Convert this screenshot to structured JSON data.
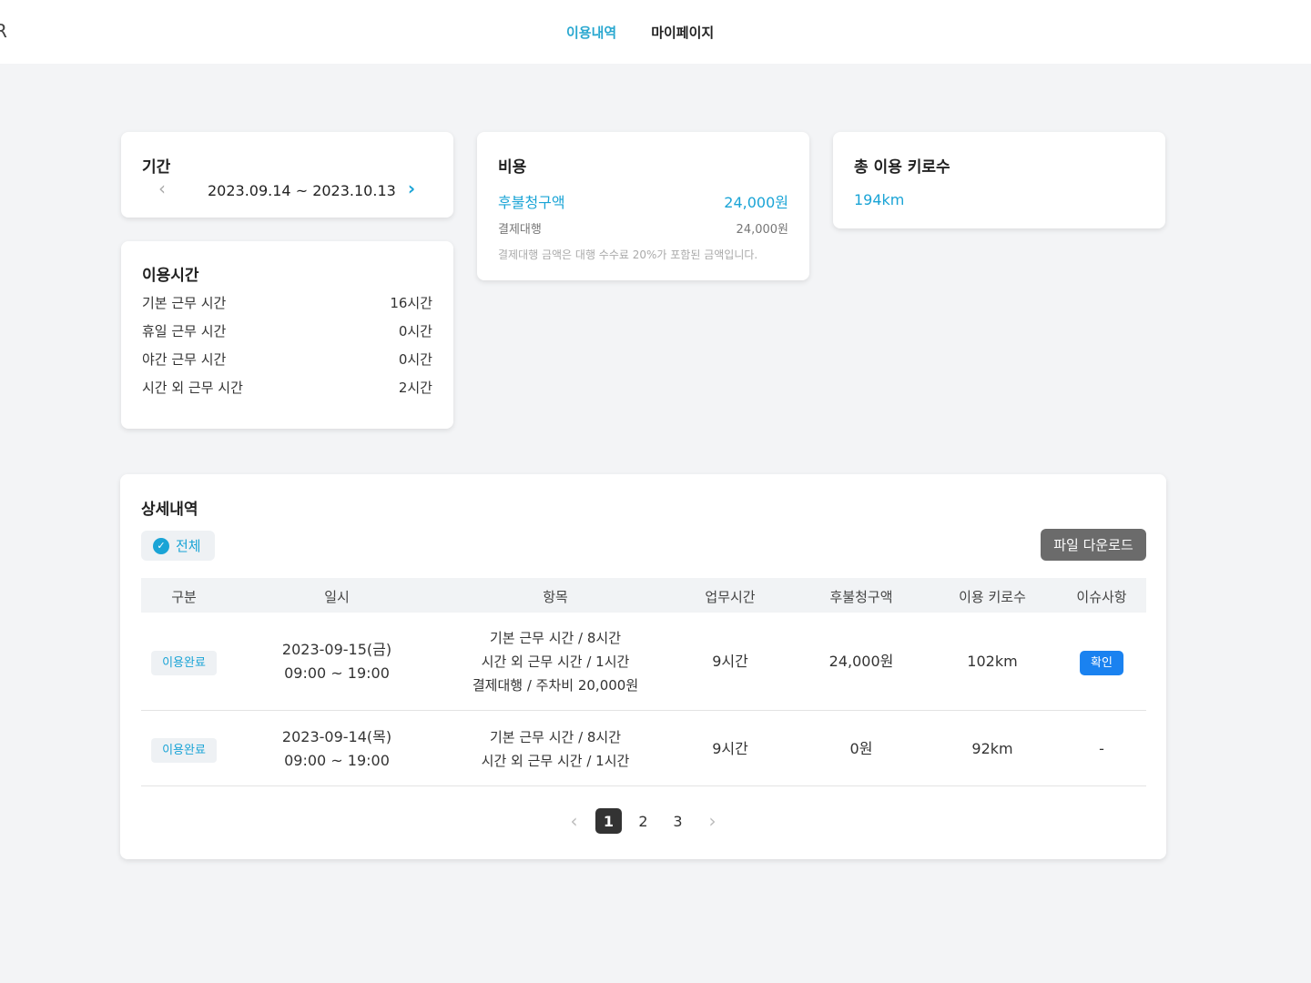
{
  "header": {
    "logo": "R",
    "nav": [
      {
        "label": "이용내역",
        "active": true
      },
      {
        "label": "마이페이지",
        "active": false
      }
    ],
    "accent_color": "#2aa8d0"
  },
  "period": {
    "title": "기간",
    "range": "2023.09.14 ~ 2023.10.13",
    "prev_icon": "chevron-left-icon",
    "next_icon": "chevron-right-icon"
  },
  "usage_time": {
    "title": "이용시간",
    "rows": [
      {
        "label": "기본 근무 시간",
        "value": "16시간"
      },
      {
        "label": "휴일 근무 시간",
        "value": "0시간"
      },
      {
        "label": "야간 근무 시간",
        "value": "0시간"
      },
      {
        "label": "시간 외 근무 시간",
        "value": "2시간"
      }
    ]
  },
  "cost": {
    "title": "비용",
    "postpaid_label": "후불청구액",
    "postpaid_value": "24,000원",
    "proxy_label": "결제대행",
    "proxy_value": "24,000원",
    "note": "결제대행 금액은 대행 수수료 20%가 포함된 금액입니다."
  },
  "total_km": {
    "title": "총 이용 키로수",
    "value": "194km"
  },
  "detail": {
    "title": "상세내역",
    "filter_label": "전체",
    "download_label": "파일 다운로드",
    "columns": [
      "구분",
      "일시",
      "항목",
      "업무시간",
      "후불청구액",
      "이용 키로수",
      "이슈사항"
    ],
    "rows": [
      {
        "status": "이용완료",
        "date": "2023-09-15(금)",
        "time": "09:00 ~ 19:00",
        "items": [
          "기본 근무 시간 / 8시간",
          "시간 외 근무 시간 / 1시간",
          "결제대행 / 주차비 20,000원"
        ],
        "work_hours": "9시간",
        "postpaid": "24,000원",
        "km": "102km",
        "issue": "확인"
      },
      {
        "status": "이용완료",
        "date": "2023-09-14(목)",
        "time": "09:00 ~ 19:00",
        "items": [
          "기본 근무 시간 / 8시간",
          "시간 외 근무 시간 / 1시간"
        ],
        "work_hours": "9시간",
        "postpaid": "0원",
        "km": "92km",
        "issue": "-"
      }
    ],
    "pagination": {
      "pages": [
        "1",
        "2",
        "3"
      ],
      "current": "1"
    }
  }
}
